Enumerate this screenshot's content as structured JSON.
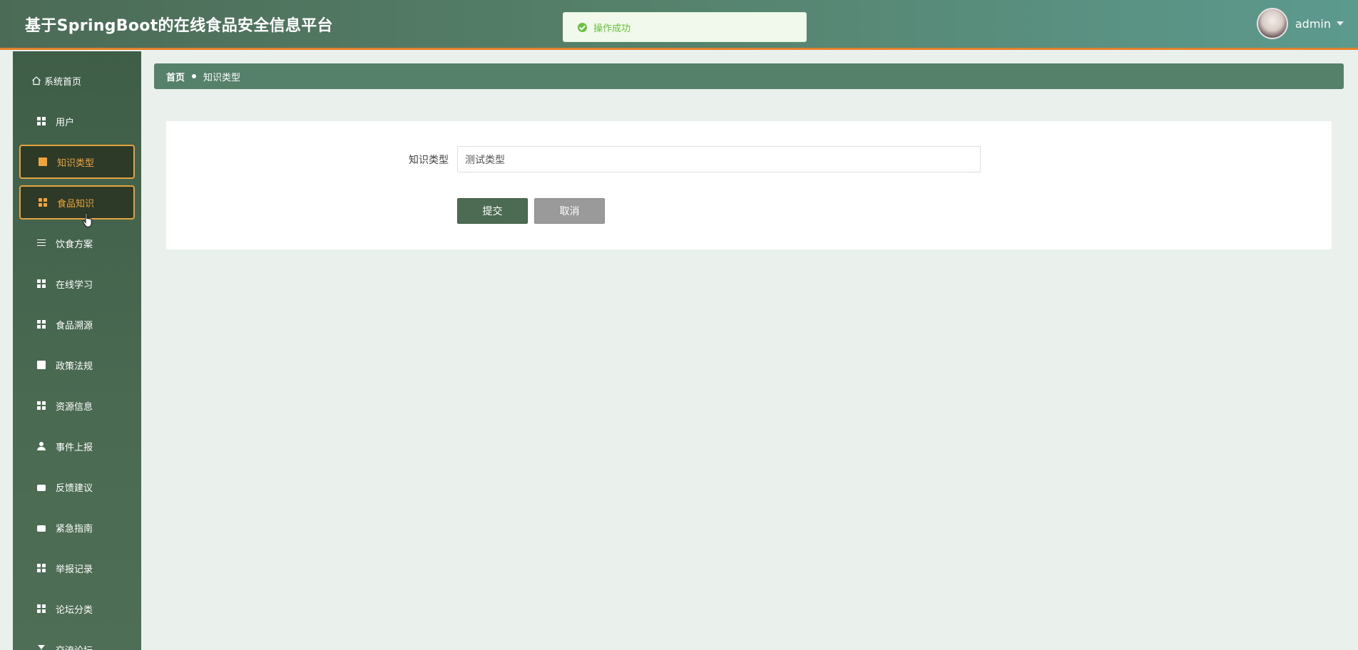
{
  "header": {
    "title": "基于SpringBoot的在线食品安全信息平台",
    "username": "admin"
  },
  "toast": {
    "message": "操作成功"
  },
  "sidebar": {
    "items": [
      {
        "label": "系统首页",
        "icon": "home-icon"
      },
      {
        "label": "用户",
        "icon": "grid-icon"
      },
      {
        "label": "知识类型",
        "icon": "chart-icon"
      },
      {
        "label": "食品知识",
        "icon": "grid-icon"
      },
      {
        "label": "饮食方案",
        "icon": "sliders-icon"
      },
      {
        "label": "在线学习",
        "icon": "grid-icon"
      },
      {
        "label": "食品溯源",
        "icon": "grid-icon"
      },
      {
        "label": "政策法规",
        "icon": "book-icon"
      },
      {
        "label": "资源信息",
        "icon": "grid-icon"
      },
      {
        "label": "事件上报",
        "icon": "user-icon"
      },
      {
        "label": "反馈建议",
        "icon": "printer-icon"
      },
      {
        "label": "紧急指南",
        "icon": "briefcase-icon"
      },
      {
        "label": "举报记录",
        "icon": "grid-icon"
      },
      {
        "label": "论坛分类",
        "icon": "grid-icon"
      },
      {
        "label": "交流论坛",
        "icon": "hourglass-icon"
      }
    ]
  },
  "breadcrumb": {
    "home": "首页",
    "current": "知识类型"
  },
  "form": {
    "field_label": "知识类型",
    "field_value": "测试类型",
    "submit_label": "提交",
    "cancel_label": "取消"
  },
  "colors": {
    "accent": "#e6a23c",
    "primary": "#4d6b53",
    "success": "#67c23a"
  }
}
